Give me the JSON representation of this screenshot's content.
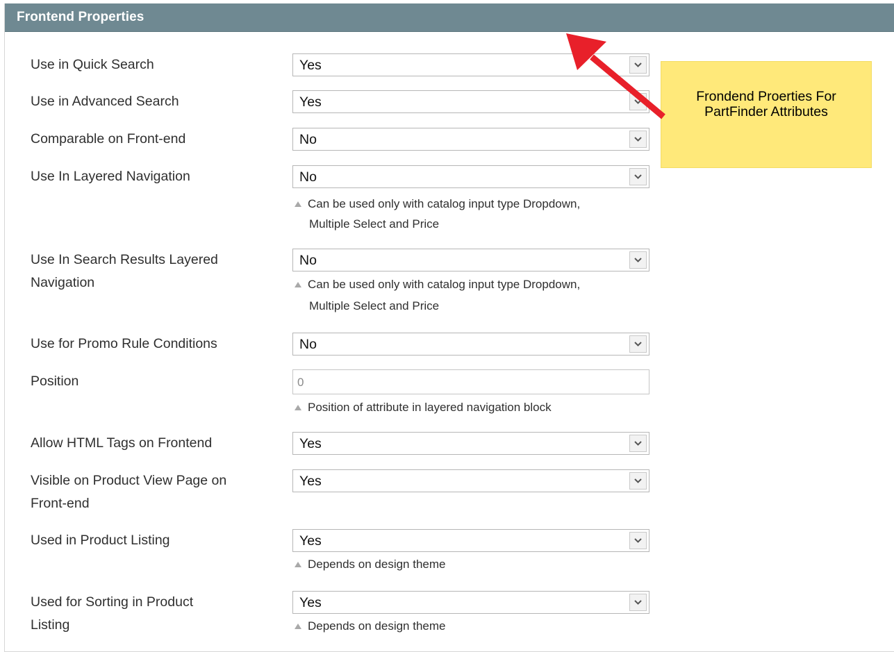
{
  "panel": {
    "title": "Frontend Properties"
  },
  "fields": {
    "quick_search": {
      "label": "Use in Quick Search",
      "value": "Yes"
    },
    "advanced_search": {
      "label": "Use in Advanced Search",
      "value": "Yes"
    },
    "comparable": {
      "label": "Comparable on Front-end",
      "value": "No"
    },
    "layered_nav": {
      "label": "Use In Layered Navigation",
      "value": "No",
      "note_1": "Can be used only with catalog input type Dropdown,",
      "note_2": "Multiple Select and Price"
    },
    "search_layered_nav": {
      "label_1": "Use In Search Results Layered",
      "label_2": "Navigation",
      "value": "No",
      "note_1": "Can be used only with catalog input type Dropdown,",
      "note_2": "Multiple Select and Price"
    },
    "promo_rule": {
      "label": "Use for Promo Rule Conditions",
      "value": "No"
    },
    "position": {
      "label": "Position",
      "value": "0",
      "note": "Position of attribute in layered navigation block"
    },
    "allow_html": {
      "label": "Allow HTML Tags on Frontend",
      "value": "Yes"
    },
    "visible_product_view": {
      "label_1": "Visible on Product View Page on",
      "label_2": "Front-end",
      "value": "Yes"
    },
    "product_listing": {
      "label": "Used in Product Listing",
      "value": "Yes",
      "note": "Depends on design theme"
    },
    "sorting": {
      "label_1": "Used for Sorting in Product",
      "label_2": "Listing",
      "value": "Yes",
      "note": "Depends on design theme"
    }
  },
  "annotation": {
    "line_1": "Frondend Proerties For",
    "line_2": "PartFinder Attributes",
    "arrow_color": "#e8202a",
    "note_color": "#ffe97a"
  }
}
